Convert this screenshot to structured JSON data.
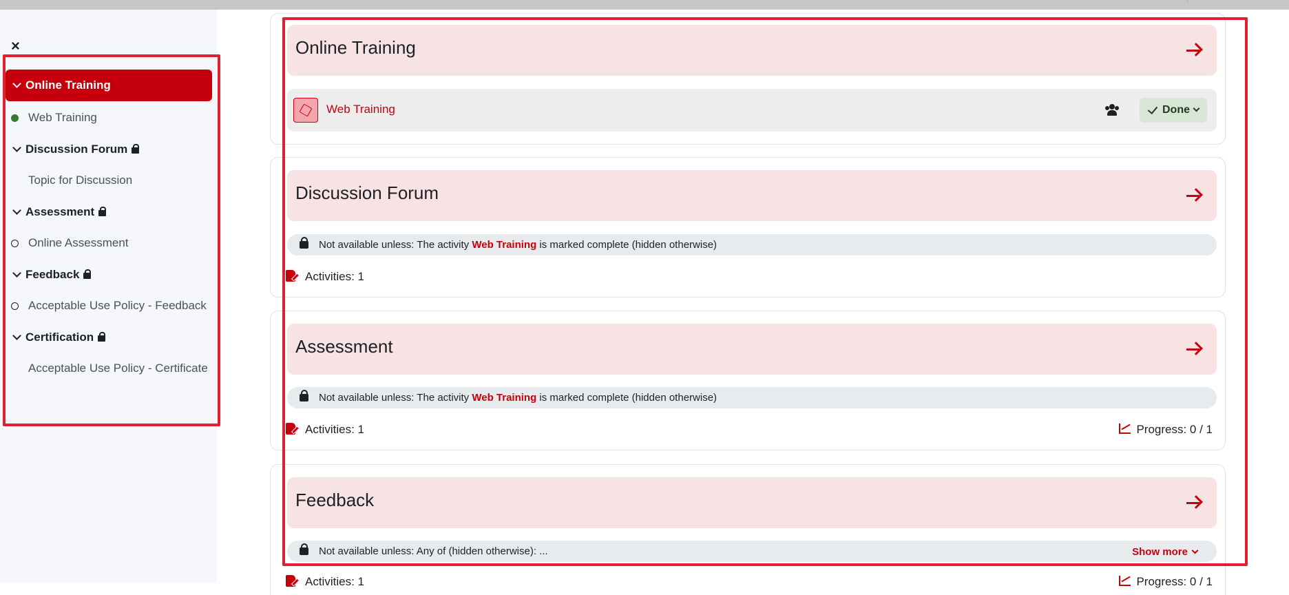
{
  "drawer": {
    "close_label": "×",
    "nav": [
      {
        "type": "section",
        "label": "Online Training",
        "active": true,
        "locked": false
      },
      {
        "type": "activity",
        "label": "Web Training",
        "status": "complete"
      },
      {
        "type": "section",
        "label": "Discussion Forum",
        "active": false,
        "locked": true
      },
      {
        "type": "activity",
        "label": "Topic for Discussion",
        "status": "none"
      },
      {
        "type": "section",
        "label": "Assessment",
        "active": false,
        "locked": true
      },
      {
        "type": "activity",
        "label": "Online Assessment",
        "status": "incomplete"
      },
      {
        "type": "section",
        "label": "Feedback",
        "active": false,
        "locked": true
      },
      {
        "type": "activity",
        "label": "Acceptable Use Policy - Feedback",
        "status": "incomplete"
      },
      {
        "type": "section",
        "label": "Certification",
        "active": false,
        "locked": true
      },
      {
        "type": "activity",
        "label": "Acceptable Use Policy - Certificate",
        "status": "none"
      }
    ]
  },
  "sections": [
    {
      "title": "Online Training",
      "activity": {
        "name": "Web Training",
        "icon": "cube-icon",
        "completion_label": "Done"
      }
    },
    {
      "title": "Discussion Forum",
      "restriction": {
        "prefix": "Not available unless: The activity ",
        "link": "Web Training",
        "suffix": " is marked complete (hidden otherwise)"
      },
      "activities_label": "Activities: 1"
    },
    {
      "title": "Assessment",
      "restriction": {
        "prefix": "Not available unless: The activity ",
        "link": "Web Training",
        "suffix": " is marked complete (hidden otherwise)"
      },
      "activities_label": "Activities: 1",
      "progress_label": "Progress: 0 / 1"
    },
    {
      "title": "Feedback",
      "restriction": {
        "prefix": "Not available unless: Any of (hidden otherwise): ...",
        "link": "",
        "suffix": ""
      },
      "show_more_label": "Show more",
      "activities_label": "Activities: 1",
      "progress_label": "Progress: 0 / 1"
    }
  ],
  "colors": {
    "brand": "#c5000c",
    "section_bg": "#f8e3e4",
    "done_bg": "#d7e6d5",
    "highlight_outline": "#e0202e"
  }
}
